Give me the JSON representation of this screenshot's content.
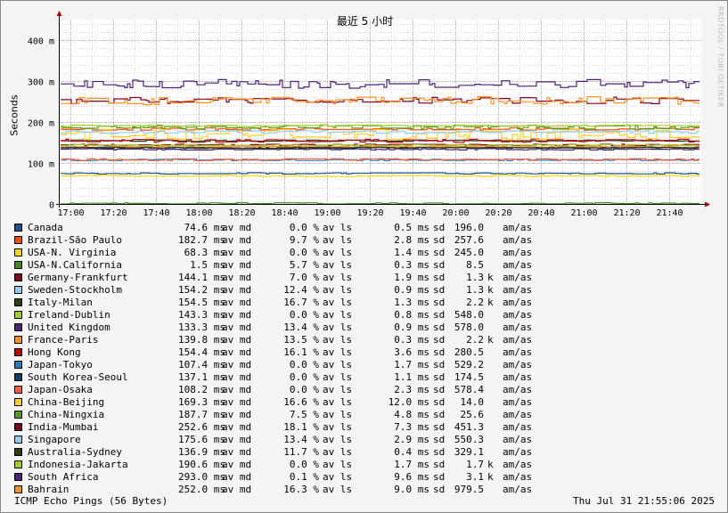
{
  "chart_data": {
    "type": "line",
    "title": "最近 5 小时",
    "ylabel": "Seconds",
    "ylim": [
      0,
      0.45
    ],
    "y_ticks": [
      {
        "value": 0,
        "label": "0"
      },
      {
        "value": 0.1,
        "label": "100 m"
      },
      {
        "value": 0.2,
        "label": "200 m"
      },
      {
        "value": 0.3,
        "label": "300 m"
      },
      {
        "value": 0.4,
        "label": "400 m"
      }
    ],
    "x_ticks": [
      "17:00",
      "17:20",
      "17:40",
      "18:00",
      "18:20",
      "18:40",
      "19:00",
      "19:20",
      "19:40",
      "20:00",
      "20:20",
      "20:40",
      "21:00",
      "21:20",
      "21:40"
    ],
    "grid": true,
    "series": [
      {
        "name": "Canada",
        "color": "#1f4f8f",
        "avg": "74.6 ms",
        "loss": "0.0 %",
        "sd": "0.5 ms",
        "am": "196.0",
        "unit": "",
        "value": 0.0746
      },
      {
        "name": "Brazil-São Paulo",
        "color": "#ff4a00",
        "avg": "182.7 ms",
        "loss": "9.7 %",
        "sd": "2.8 ms",
        "am": "257.6",
        "unit": "",
        "value": 0.1827
      },
      {
        "name": "USA-N. Virginia",
        "color": "#ffd800",
        "avg": "68.3 ms",
        "loss": "0.0 %",
        "sd": "1.4 ms",
        "am": "245.0",
        "unit": "",
        "value": 0.0683
      },
      {
        "name": "USA-N.California",
        "color": "#3a8f1f",
        "avg": "1.5 ms",
        "loss": "5.7 %",
        "sd": "0.3 ms",
        "am": "8.5",
        "unit": "",
        "value": 0.0015
      },
      {
        "name": "Germany-Frankfurt",
        "color": "#8b0018",
        "avg": "144.1 ms",
        "loss": "7.0 %",
        "sd": "1.9 ms",
        "am": "1.3",
        "unit": "k",
        "value": 0.1441
      },
      {
        "name": "Sweden-Stockholm",
        "color": "#8fcdf5",
        "avg": "154.2 ms",
        "loss": "12.4 %",
        "sd": "0.9 ms",
        "am": "1.3",
        "unit": "k",
        "value": 0.1542
      },
      {
        "name": "Italy-Milan",
        "color": "#2f3f0a",
        "avg": "154.5 ms",
        "loss": "16.7 %",
        "sd": "1.3 ms",
        "am": "2.2",
        "unit": "k",
        "value": 0.1545
      },
      {
        "name": "Ireland-Dublin",
        "color": "#9fcf1f",
        "avg": "143.3 ms",
        "loss": "0.0 %",
        "sd": "0.8 ms",
        "am": "548.0",
        "unit": "",
        "value": 0.1433
      },
      {
        "name": "United Kingdom",
        "color": "#4f1f7f",
        "avg": "133.3 ms",
        "loss": "13.4 %",
        "sd": "0.9 ms",
        "am": "578.0",
        "unit": "",
        "value": 0.1333
      },
      {
        "name": "France-Paris",
        "color": "#ff8f1f",
        "avg": "139.8 ms",
        "loss": "13.5 %",
        "sd": "0.3 ms",
        "am": "2.2",
        "unit": "k",
        "value": 0.1398
      },
      {
        "name": "Hong Kong",
        "color": "#c80000",
        "avg": "154.4 ms",
        "loss": "16.1 %",
        "sd": "3.6 ms",
        "am": "280.5",
        "unit": "",
        "value": 0.1544
      },
      {
        "name": "Japan-Tokyo",
        "color": "#1f7fbf",
        "avg": "107.4 ms",
        "loss": "0.0 %",
        "sd": "1.7 ms",
        "am": "529.2",
        "unit": "",
        "value": 0.1074
      },
      {
        "name": "South Korea-Seoul",
        "color": "#0f3f6f",
        "avg": "137.1 ms",
        "loss": "0.0 %",
        "sd": "1.1 ms",
        "am": "174.5",
        "unit": "",
        "value": 0.1371
      },
      {
        "name": "Japan-Osaka",
        "color": "#ff5a3a",
        "avg": "108.2 ms",
        "loss": "0.0 %",
        "sd": "2.3 ms",
        "am": "578.4",
        "unit": "",
        "value": 0.1082
      },
      {
        "name": "China-Beijing",
        "color": "#ffcf1f",
        "avg": "169.3 ms",
        "loss": "16.6 %",
        "sd": "12.0 ms",
        "am": "14.0",
        "unit": "",
        "value": 0.1693
      },
      {
        "name": "China-Ningxia",
        "color": "#4f9f1f",
        "avg": "187.7 ms",
        "loss": "7.5 %",
        "sd": "4.8 ms",
        "am": "25.6",
        "unit": "",
        "value": 0.1877
      },
      {
        "name": "India-Mumbai",
        "color": "#7f0020",
        "avg": "252.6 ms",
        "loss": "18.1 %",
        "sd": "7.3 ms",
        "am": "451.3",
        "unit": "",
        "value": 0.2526
      },
      {
        "name": "Singapore",
        "color": "#8fcdf5",
        "avg": "175.6 ms",
        "loss": "13.4 %",
        "sd": "2.9 ms",
        "am": "550.3",
        "unit": "",
        "value": 0.1756
      },
      {
        "name": "Australia-Sydney",
        "color": "#2f3f0a",
        "avg": "136.9 ms",
        "loss": "11.7 %",
        "sd": "0.4 ms",
        "am": "329.1",
        "unit": "",
        "value": 0.1369
      },
      {
        "name": "Indonesia-Jakarta",
        "color": "#9fcf1f",
        "avg": "190.6 ms",
        "loss": "0.0 %",
        "sd": "1.7 ms",
        "am": "1.7",
        "unit": "k",
        "value": 0.1906
      },
      {
        "name": "South Africa",
        "color": "#4f1f7f",
        "avg": "293.0 ms",
        "loss": "0.1 %",
        "sd": "9.6 ms",
        "am": "3.1",
        "unit": "k",
        "value": 0.293
      },
      {
        "name": "Bahrain",
        "color": "#ff8f1f",
        "avg": "252.0 ms",
        "loss": "16.3 %",
        "sd": "9.0 ms",
        "am": "979.5",
        "unit": "",
        "value": 0.252
      }
    ],
    "legend_tags": {
      "avg": "av md",
      "loss": "av ls",
      "sd": "sd",
      "am": "am/as"
    }
  },
  "footer": {
    "left": "ICMP Echo Pings (56 Bytes)",
    "right": "Thu Jul 31 21:55:06 2025"
  },
  "watermark": "RRDTOOL / TOBI OETIKER"
}
